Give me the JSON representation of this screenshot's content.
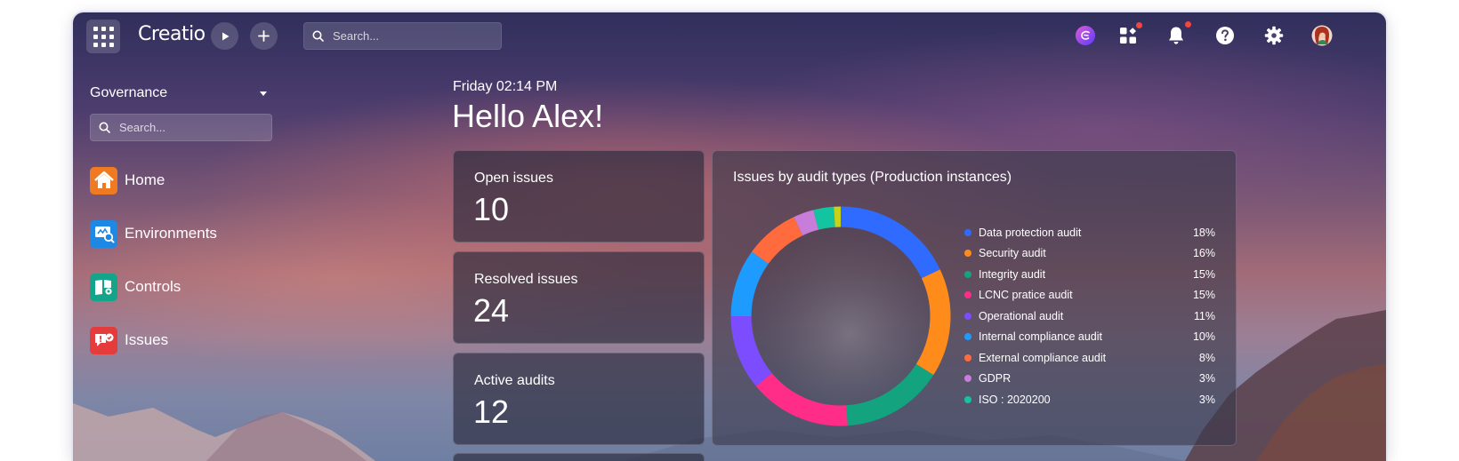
{
  "app": {
    "logo": "Creatio",
    "search_placeholder": "Search..."
  },
  "sidebar": {
    "workspace": "Governance",
    "search_placeholder": "Search...",
    "items": [
      {
        "label": "Home",
        "icon": "home-icon",
        "color": "#f07a22"
      },
      {
        "label": "Environments",
        "icon": "environments-icon",
        "color": "#1e88e5"
      },
      {
        "label": "Controls",
        "icon": "controls-icon",
        "color": "#12a58a"
      },
      {
        "label": "Issues",
        "icon": "issues-icon",
        "color": "#e53b3b"
      }
    ]
  },
  "main": {
    "datetime": "Friday 02:14 PM",
    "greeting": "Hello Alex!",
    "cards": [
      {
        "label": "Open issues",
        "value": "10"
      },
      {
        "label": "Resolved issues",
        "value": "24"
      },
      {
        "label": "Active audits",
        "value": "12"
      }
    ]
  },
  "chart_data": {
    "type": "pie",
    "title": "Issues by audit types (Production instances)",
    "legend_position": "right",
    "series": [
      {
        "name": "Data protection audit",
        "value": 18,
        "label": "18%",
        "color": "#2f6bff"
      },
      {
        "name": "Security audit",
        "value": 16,
        "label": "16%",
        "color": "#ff8c1a"
      },
      {
        "name": "Integrity audit",
        "value": 15,
        "label": "15%",
        "color": "#14a37f"
      },
      {
        "name": "LCNC pratice audit",
        "value": 15,
        "label": "15%",
        "color": "#ff2d87"
      },
      {
        "name": "Operational audit",
        "value": 11,
        "label": "11%",
        "color": "#7b4dff"
      },
      {
        "name": "Internal compliance audit",
        "value": 10,
        "label": "10%",
        "color": "#1e9bff"
      },
      {
        "name": "External compliance audit",
        "value": 8,
        "label": "8%",
        "color": "#ff6b3d"
      },
      {
        "name": "GDPR",
        "value": 3,
        "label": "3%",
        "color": "#c77dd9"
      },
      {
        "name": "ISO : 2020200",
        "value": 3,
        "label": "3%",
        "color": "#12c4a0"
      },
      {
        "value": 1,
        "color": "#c6d21a"
      }
    ]
  }
}
